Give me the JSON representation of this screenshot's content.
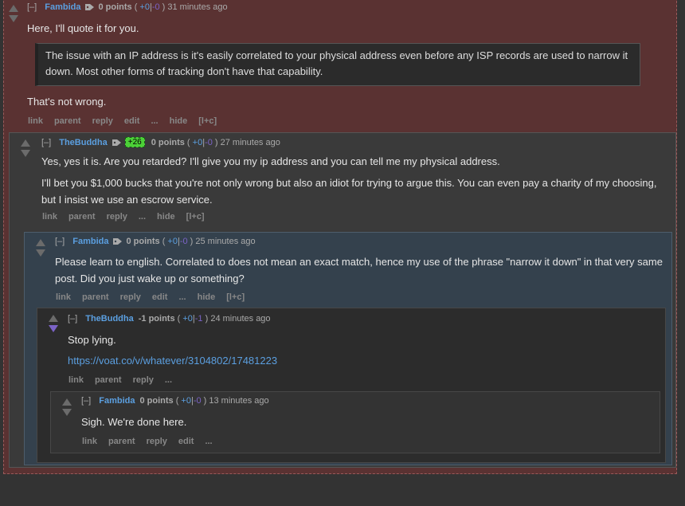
{
  "comments": [
    {
      "collapse": "[–]",
      "author": "Fambida",
      "score_label": "0 points",
      "up": "+0",
      "down": "-0",
      "age": "31 minutes ago",
      "intro": "Here, I'll quote it for you.",
      "quote": "The issue with an IP address is it's easily correlated to your physical address even before any ISP records are used to narrow it down. Most other forms of tracking don't have that capability.",
      "outro": "That's not wrong.",
      "actions": [
        "link",
        "parent",
        "reply",
        "edit",
        "...",
        "hide",
        "[l+c]"
      ]
    },
    {
      "collapse": "[–]",
      "author": "TheBuddha",
      "flair": "+26",
      "score_label": "0 points",
      "up": "+0",
      "down": "-0",
      "age": "27 minutes ago",
      "p1": "Yes, yes it is. Are you retarded? I'll give you my ip address and you can tell me my physical address.",
      "p2": "I'll bet you $1,000 bucks that you're not only wrong but also an idiot for trying to argue this. You can even pay a charity of my choosing, but I insist we use an escrow service.",
      "actions": [
        "link",
        "parent",
        "reply",
        "...",
        "hide",
        "[l+c]"
      ]
    },
    {
      "collapse": "[–]",
      "author": "Fambida",
      "score_label": "0 points",
      "up": "+0",
      "down": "-0",
      "age": "25 minutes ago",
      "p1": "Please learn to english. Correlated to does not mean an exact match, hence my use of the phrase \"narrow it down\" in that very same post. Did you just wake up or something?",
      "actions": [
        "link",
        "parent",
        "reply",
        "edit",
        "...",
        "hide",
        "[l+c]"
      ]
    },
    {
      "collapse": "[–]",
      "author": "TheBuddha",
      "score_label": "-1 points",
      "up": "+0",
      "down": "-1",
      "age": "24 minutes ago",
      "p1": "Stop lying.",
      "url": "https://voat.co/v/whatever/3104802/17481223",
      "actions": [
        "link",
        "parent",
        "reply",
        "..."
      ]
    },
    {
      "collapse": "[–]",
      "author": "Fambida",
      "score_label": "0 points",
      "up": "+0",
      "down": "-0",
      "age": "13 minutes ago",
      "p1": "Sigh. We're done here.",
      "actions": [
        "link",
        "parent",
        "reply",
        "edit",
        "..."
      ]
    }
  ],
  "colors": {
    "page_bg": "#333333",
    "highlight_bg": "#5a3232",
    "author": "#5b9fe0",
    "downvote_active": "#7b63c7",
    "flair_bg": "#4cd137"
  }
}
